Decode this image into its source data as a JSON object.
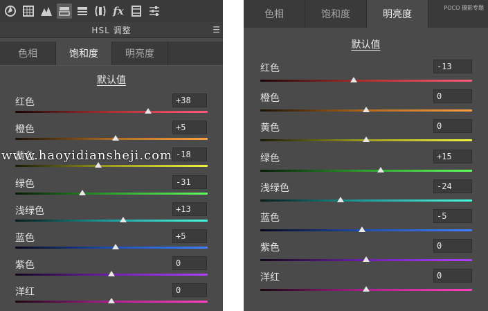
{
  "left": {
    "panel_title": "HSL 调整",
    "tabs": [
      {
        "label": "色相",
        "active": false
      },
      {
        "label": "饱和度",
        "active": true
      },
      {
        "label": "明亮度",
        "active": false
      }
    ],
    "section_title": "默认值",
    "rows": [
      {
        "label": "红色",
        "value": "+38",
        "position": 0.69
      },
      {
        "label": "橙色",
        "value": "+5",
        "position": 0.52
      },
      {
        "label": "黄色",
        "value": "-18",
        "position": 0.43
      },
      {
        "label": "绿色",
        "value": "-31",
        "position": 0.35
      },
      {
        "label": "浅绿色",
        "value": "+13",
        "position": 0.56
      },
      {
        "label": "蓝色",
        "value": "+5",
        "position": 0.52
      },
      {
        "label": "紫色",
        "value": "0",
        "position": 0.5
      },
      {
        "label": "洋红",
        "value": "0",
        "position": 0.5
      }
    ]
  },
  "right": {
    "tabs": [
      {
        "label": "色相",
        "active": false
      },
      {
        "label": "饱和度",
        "active": false
      },
      {
        "label": "明亮度",
        "active": true
      }
    ],
    "logo_text": "POCO 摄影专题",
    "section_title": "默认值",
    "rows": [
      {
        "label": "红色",
        "value": "-13",
        "position": 0.44
      },
      {
        "label": "橙色",
        "value": "0",
        "position": 0.5
      },
      {
        "label": "黄色",
        "value": "0",
        "position": 0.5
      },
      {
        "label": "绿色",
        "value": "+15",
        "position": 0.57
      },
      {
        "label": "浅绿色",
        "value": "-24",
        "position": 0.38
      },
      {
        "label": "蓝色",
        "value": "-5",
        "position": 0.48
      },
      {
        "label": "紫色",
        "value": "0",
        "position": 0.5
      },
      {
        "label": "洋红",
        "value": "0",
        "position": 0.5
      }
    ]
  },
  "watermark": "www.haoyidiansheji.com",
  "track_colors": {
    "red": "linear-gradient(to right,#1a0606,#b03030,#ff5a7a)",
    "orange": "linear-gradient(to right,#1a1006,#b06a20,#ffa040)",
    "yellow": "linear-gradient(to right,#1a1a06,#a0a020,#f0f040)",
    "green": "linear-gradient(to right,#061a06,#30a030,#60ff60)",
    "aqua": "linear-gradient(to right,#061a1a,#20a0a0,#40ffe0)",
    "blue": "linear-gradient(to right,#06061a,#2050b0,#4080ff)",
    "purple": "linear-gradient(to right,#12061a,#7020b0,#b040ff)",
    "magenta": "linear-gradient(to right,#1a0612,#b02090,#ff40c0)"
  }
}
